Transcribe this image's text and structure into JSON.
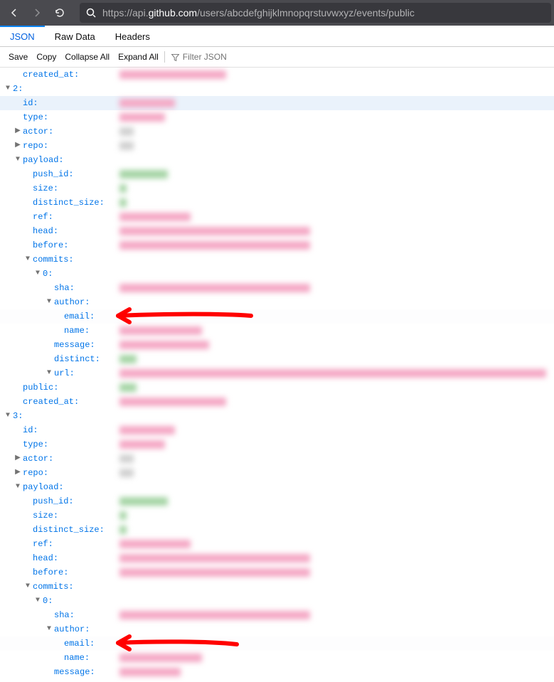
{
  "url": {
    "prefix": "https://api.",
    "host": "github.com",
    "path": "/users/abcdefghijklmnopqrstuvwxyz/events/public"
  },
  "tabs": {
    "json": "JSON",
    "raw": "Raw Data",
    "headers": "Headers"
  },
  "toolbar": {
    "save": "Save",
    "copy": "Copy",
    "collapse": "Collapse All",
    "expand": "Expand All",
    "filter": "Filter JSON"
  },
  "keys": {
    "created_at": "created_at",
    "id": "id",
    "type": "type",
    "actor": "actor",
    "repo": "repo",
    "payload": "payload",
    "push_id": "push_id",
    "size": "size",
    "distinct_size": "distinct_size",
    "ref": "ref",
    "head": "head",
    "before": "before",
    "commits": "commits",
    "sha": "sha",
    "author": "author",
    "email": "email",
    "name": "name",
    "message": "message",
    "distinct": "distinct",
    "url": "url",
    "public": "public",
    "idx0": "0",
    "idx2": "2",
    "idx3": "3"
  }
}
